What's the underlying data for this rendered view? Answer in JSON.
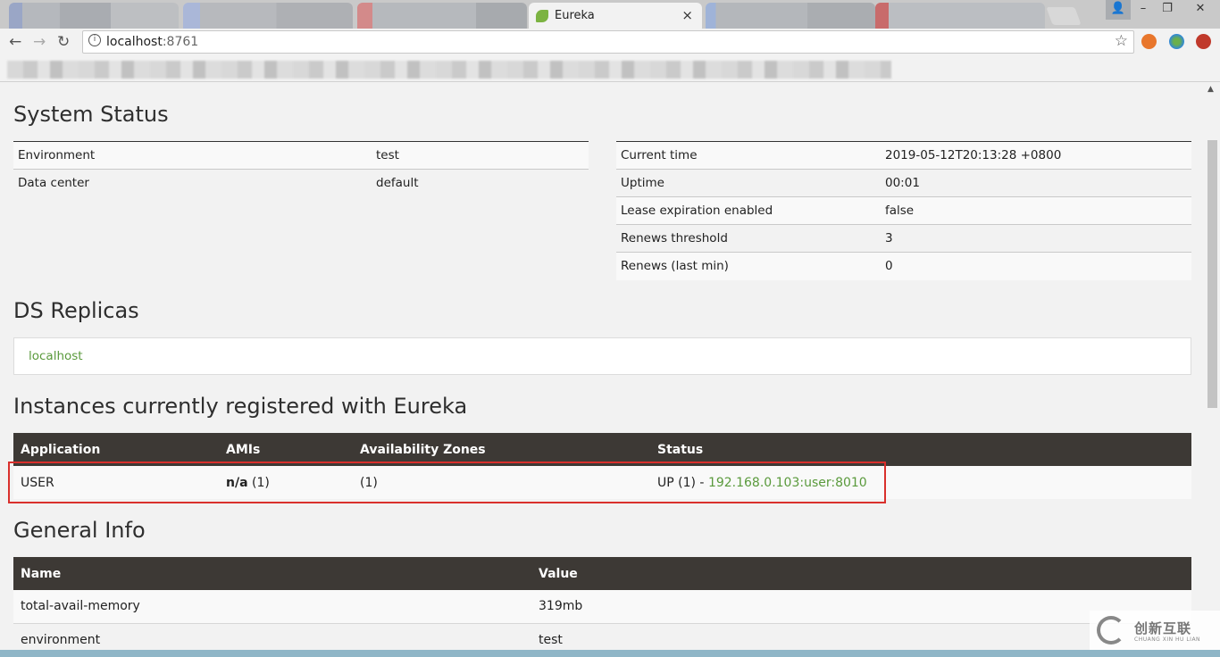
{
  "browser": {
    "active_tab_title": "Eureka",
    "tab_close": "×",
    "url_host": "localhost",
    "url_port": ":8761",
    "window_min": "–",
    "window_max": "❐",
    "window_close": "✕",
    "user_icon": "👤"
  },
  "page": {
    "system_status": {
      "heading": "System Status",
      "left": [
        {
          "key": "Environment",
          "value": "test"
        },
        {
          "key": "Data center",
          "value": "default"
        }
      ],
      "right": [
        {
          "key": "Current time",
          "value": "2019-05-12T20:13:28 +0800"
        },
        {
          "key": "Uptime",
          "value": "00:01"
        },
        {
          "key": "Lease expiration enabled",
          "value": "false"
        },
        {
          "key": "Renews threshold",
          "value": "3"
        },
        {
          "key": "Renews (last min)",
          "value": "0"
        }
      ]
    },
    "ds_replicas": {
      "heading": "DS Replicas",
      "link": "localhost"
    },
    "instances": {
      "heading": "Instances currently registered with Eureka",
      "columns": [
        "Application",
        "AMIs",
        "Availability Zones",
        "Status"
      ],
      "rows": [
        {
          "application": "USER",
          "amis_value": "n/a",
          "amis_count": "(1)",
          "zones": "(1)",
          "status_prefix": "UP (1) -",
          "status_link": "192.168.0.103:user:8010"
        }
      ]
    },
    "general_info": {
      "heading": "General Info",
      "columns": [
        "Name",
        "Value"
      ],
      "rows": [
        {
          "name": "total-avail-memory",
          "value": "319mb"
        },
        {
          "name": "environment",
          "value": "test"
        }
      ]
    }
  },
  "watermark": {
    "text": "创新互联",
    "sub": "CHUANG XIN HU LIAN"
  }
}
